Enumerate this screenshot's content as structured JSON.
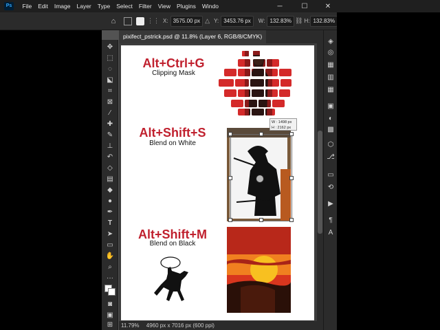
{
  "app": {
    "logo": "Ps"
  },
  "menu": [
    "File",
    "Edit",
    "Image",
    "Layer",
    "Type",
    "Select",
    "Filter",
    "View",
    "Plugins",
    "Windo"
  ],
  "options": {
    "x_label": "X:",
    "x_value": "3575.00 px",
    "y_label": "Y:",
    "y_value": "3453.76 px",
    "w_label": "W:",
    "w_value": "132.83%",
    "h_label": "H:",
    "h_value": "132.83%"
  },
  "document": {
    "tab_title": "pixifect_pstrick.psd @ 11.8% (Layer 6, RGB/8/CMYK)",
    "zoom": "11.79%",
    "dimensions": "4960 px x 7016 px (600 ppi)"
  },
  "artwork": {
    "blocks": [
      {
        "shortcut": "Alt+Ctrl+G",
        "label": "Clipping Mask"
      },
      {
        "shortcut": "Alt+Shift+S",
        "label": "Blend on White"
      },
      {
        "shortcut": "Alt+Shift+M",
        "label": "Blend on Black"
      }
    ],
    "tooltip_w": "W : 1498 px",
    "tooltip_h": "H : 2162 px"
  },
  "icons": {
    "toolbar": [
      "move-icon",
      "marquee-icon",
      "lasso-icon",
      "object-select-icon",
      "crop-icon",
      "frame-icon",
      "eyedropper-icon",
      "healing-brush-icon",
      "brush-icon",
      "clone-stamp-icon",
      "history-brush-icon",
      "eraser-icon",
      "gradient-icon",
      "blur-icon",
      "dodge-icon",
      "pen-icon",
      "type-icon",
      "path-select-icon",
      "rectangle-icon",
      "hand-icon",
      "zoom-icon",
      "more-tools-icon",
      "color-swatches-icon",
      "quick-mask-icon",
      "screen-mode-icon",
      "artboard-icon"
    ],
    "right_dock": [
      "layers-icon",
      "channels-icon",
      "paths-icon",
      "adjustments-icon",
      "properties-icon",
      "libraries-icon",
      "color-icon",
      "swatches-icon",
      "styles-icon",
      "comments-icon",
      "actions-icon",
      "history-icon",
      "play-icon",
      "paragraph-icon",
      "character-icon"
    ]
  },
  "colors": {
    "accent_red": "#c0202e",
    "app_bg": "#2b2b2b"
  }
}
